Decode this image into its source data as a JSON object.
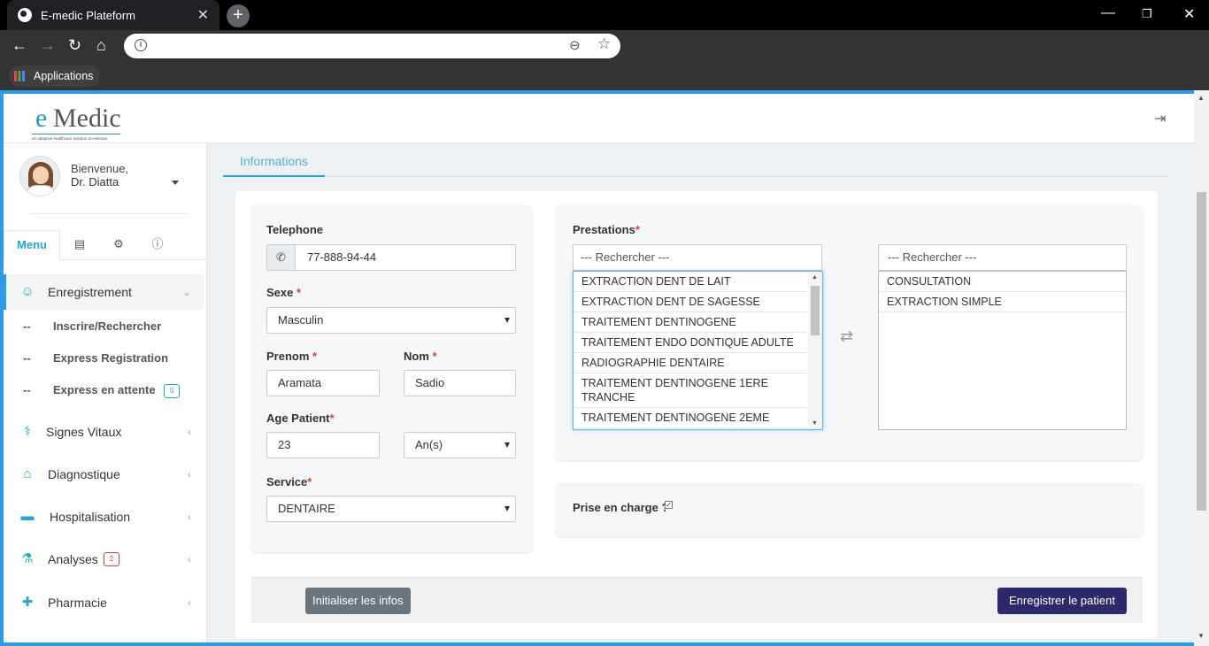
{
  "browser": {
    "tab_title": "E-medic Plateform",
    "bookmark_label": "Applications",
    "url": ""
  },
  "brand": {
    "logo_e": "e",
    "logo_rest": "Medic",
    "tagline": "an adaptive healthcare solution accelerator"
  },
  "user": {
    "greeting": "Bienvenue,",
    "name": "Dr. Diatta"
  },
  "menu_tabs": {
    "menu": "Menu"
  },
  "nav": {
    "enregistrement": "Enregistrement",
    "sub_inscrire": "Inscrire/Rechercher",
    "sub_express": "Express Registration",
    "sub_attente": "Express en attente",
    "sub_attente_count": "0",
    "sub_dash": "--",
    "signes": "Signes Vitaux",
    "diagnostique": "Diagnostique",
    "hospitalisation": "Hospitalisation",
    "analyses": "Analyses",
    "analyses_count": "2",
    "pharmacie": "Pharmacie"
  },
  "tab_label": "Informations",
  "form": {
    "telephone_label": "Telephone",
    "telephone_value": "77-888-94-44",
    "sexe_label": "Sexe",
    "sexe_value": "Masculin",
    "prenom_label": "Prenom",
    "prenom_value": "Aramata",
    "nom_label": "Nom",
    "nom_value": "Sadio",
    "age_label": "Age Patient",
    "age_value": "23",
    "age_unit": "An(s)",
    "service_label": "Service",
    "service_value": "DENTAIRE",
    "required_mark": "*"
  },
  "prestations": {
    "label": "Prestations",
    "search_placeholder": "--- Rechercher ---",
    "available": [
      "EXTRACTION DENT DE LAIT",
      "EXTRACTION DENT DE SAGESSE",
      "TRAITEMENT DENTINOGENE",
      "TRAITEMENT ENDO DONTIQUE ADULTE",
      "RADIOGRAPHIE DENTAIRE",
      "TRAITEMENT DENTINOGENE 1ERE TRANCHE",
      "TRAITEMENT DENTINOGENE 2EME"
    ],
    "selected": [
      "CONSULTATION",
      "EXTRACTION SIMPLE"
    ]
  },
  "prise_en_charge": {
    "label": "Prise en charge ?",
    "checked": true
  },
  "buttons": {
    "reset": "Initialiser les infos",
    "save": "Enregistrer le patient"
  },
  "colors": {
    "accent": "#20a8d8",
    "reset_btn": "#6c757d",
    "save_btn": "#2c2a6b"
  }
}
